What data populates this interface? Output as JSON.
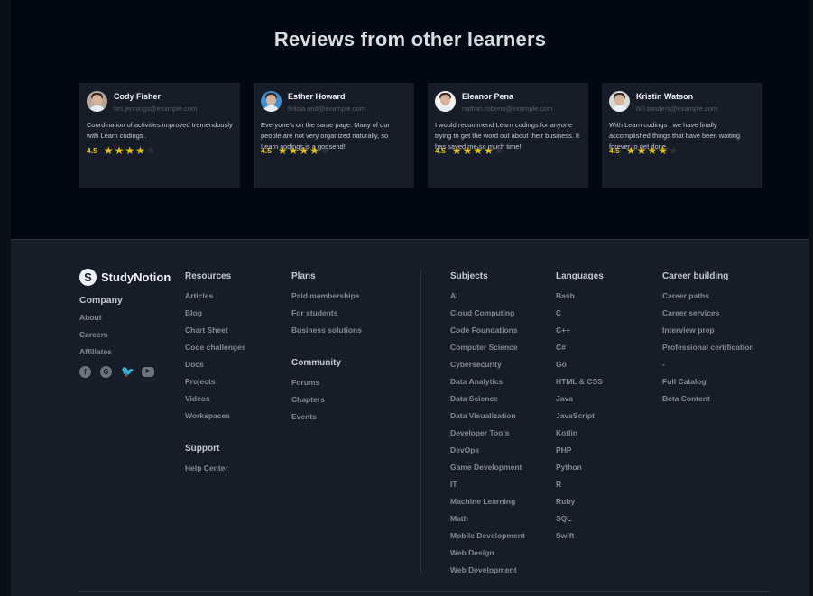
{
  "reviews": {
    "title": "Reviews from other learners",
    "items": [
      {
        "name": "Cody Fisher",
        "email": "tim.jennings@example.com",
        "text": "Coordination of activities improved tremendously with Learn codings .",
        "rating": "4.5",
        "stars": 4,
        "avatar_bg": "#b7a79a"
      },
      {
        "name": "Esther Howard",
        "email": "felicia.reid@example.com",
        "text": "Everyone’s on the same page. Many of our people are not very organized naturally, so Learn codings is a godsend!",
        "rating": "4.5",
        "stars": 4,
        "avatar_bg": "#3a8fd6"
      },
      {
        "name": "Eleanor Pena",
        "email": "nathan.roberts@example.com",
        "text": "I would recommend Learn codings for anyone trying to get the word out about their business. It has saved me so much time!",
        "rating": "4.5",
        "stars": 4,
        "avatar_bg": "#f2f2f2"
      },
      {
        "name": "Kristin Watson",
        "email": "bill.sanders@example.com",
        "text": "With Learn codings , we have finally accomplished things that have been waiting forever to get done.",
        "rating": "4.5",
        "stars": 4,
        "avatar_bg": "#d9d9d9"
      }
    ]
  },
  "footer": {
    "brand": {
      "mark": "S",
      "name": "StudyNotion"
    },
    "company": {
      "title": "Company",
      "links": [
        "About",
        "Careers",
        "Affiliates"
      ],
      "social": [
        {
          "icon": "facebook-icon",
          "glyph": "f"
        },
        {
          "icon": "google-icon",
          "glyph": "G"
        },
        {
          "icon": "twitter-icon",
          "glyph": "🐦"
        },
        {
          "icon": "youtube-icon",
          "glyph": "▶"
        }
      ]
    },
    "resources": {
      "title": "Resources",
      "links": [
        "Articles",
        "Blog",
        "Chart Sheet",
        "Code challenges",
        "Docs",
        "Projects",
        "Videos",
        "Workspaces"
      ]
    },
    "support": {
      "title": "Support",
      "links": [
        "Help Center"
      ]
    },
    "plans": {
      "title": "Plans",
      "links": [
        "Paid memberships",
        "For students",
        "Business solutions"
      ]
    },
    "community": {
      "title": "Community",
      "links": [
        "Forums",
        "Chapters",
        "Events"
      ]
    },
    "subjects": {
      "title": "Subjects",
      "links": [
        "AI",
        "Cloud Computing",
        "Code Foundations",
        "Computer Science",
        "Cybersecurity",
        "Data Analytics",
        "Data Science",
        "Data Visualization",
        "Developer Tools",
        "DevOps",
        "Game Development",
        "IT",
        "Machine Learning",
        "Math",
        "Mobile Development",
        "Web Design",
        "Web Development"
      ]
    },
    "languages": {
      "title": "Languages",
      "links": [
        "Bash",
        "C",
        "C++",
        "C#",
        "Go",
        "HTML & CSS",
        "Java",
        "JavaScript",
        "Kotlin",
        "PHP",
        "Python",
        "R",
        "Ruby",
        "SQL",
        "Swift"
      ]
    },
    "career": {
      "title": "Career building",
      "links": [
        "Career paths",
        "Career services",
        "Interview prep",
        "Professional certification",
        "-",
        "Full Catalog",
        "Beta Content"
      ]
    }
  },
  "colors": {
    "page_bg": "#000814",
    "card_bg": "#161d29",
    "footer_bg": "#161d29",
    "star": "#e7c009",
    "link": "#838894"
  }
}
